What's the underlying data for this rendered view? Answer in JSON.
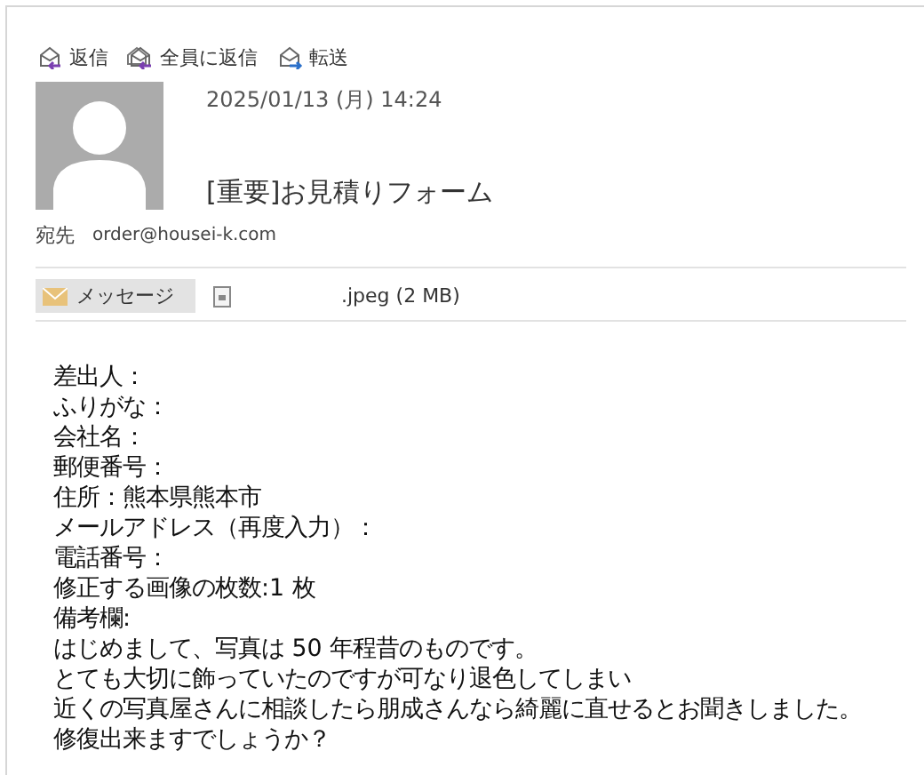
{
  "actions": [
    {
      "kind": "reply",
      "label": "返信"
    },
    {
      "kind": "reply_all",
      "label": "全員に返信"
    },
    {
      "kind": "forward",
      "label": "転送"
    }
  ],
  "message": {
    "date": "2025/01/13 (月) 14:24",
    "subject": "[重要]お見積りフォーム",
    "to_label": "宛先",
    "to": "order@housei-k.com"
  },
  "tabs": [
    {
      "kind": "message",
      "label": "メッセージ",
      "selected": true
    },
    {
      "kind": "file",
      "label": ".jpeg (2 MB)",
      "selected": false
    }
  ],
  "body": [
    "差出人：",
    "ふりがな：",
    "会社名：",
    "郵便番号：",
    "住所：熊本県熊本市",
    "メールアドレス（再度入力）：",
    "電話番号：",
    "修正する画像の枚数:1 枚",
    "備考欄:",
    "はじめまして、写真は 50 年程昔のものです。",
    "とても大切に飾っていたのですが可なり退色してしまい",
    "近くの写真屋さんに相談したら朋成さんなら綺麗に直せるとお聞きしました。",
    "修復出来ますでしょうか？"
  ]
}
